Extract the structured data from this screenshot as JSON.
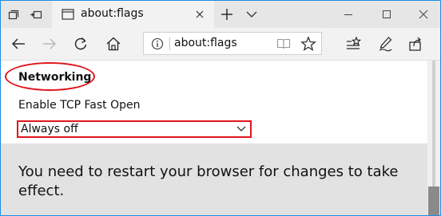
{
  "tab": {
    "title": "about:flags"
  },
  "address_bar": {
    "url": "about:flags"
  },
  "flags": {
    "section_heading": "Networking",
    "setting_label": "Enable TCP Fast Open",
    "setting_value": "Always off"
  },
  "restart_banner": {
    "message": "You need to restart your browser for changes to take effect."
  },
  "icons": {
    "tab_bar": [
      "tab-manager-icon",
      "set-aside-tabs-icon",
      "page-icon",
      "close-icon",
      "plus-icon",
      "chevron-down-icon"
    ],
    "window_controls": [
      "minimize-icon",
      "maximize-icon",
      "close-icon"
    ],
    "toolbar": [
      "back-arrow-icon",
      "forward-arrow-icon",
      "refresh-icon",
      "home-icon",
      "info-icon",
      "reading-view-icon",
      "star-icon",
      "favorites-icon",
      "pen-icon",
      "share-icon"
    ]
  },
  "colors": {
    "highlight_red": "#e0151b",
    "window_border": "#1e8be2"
  }
}
